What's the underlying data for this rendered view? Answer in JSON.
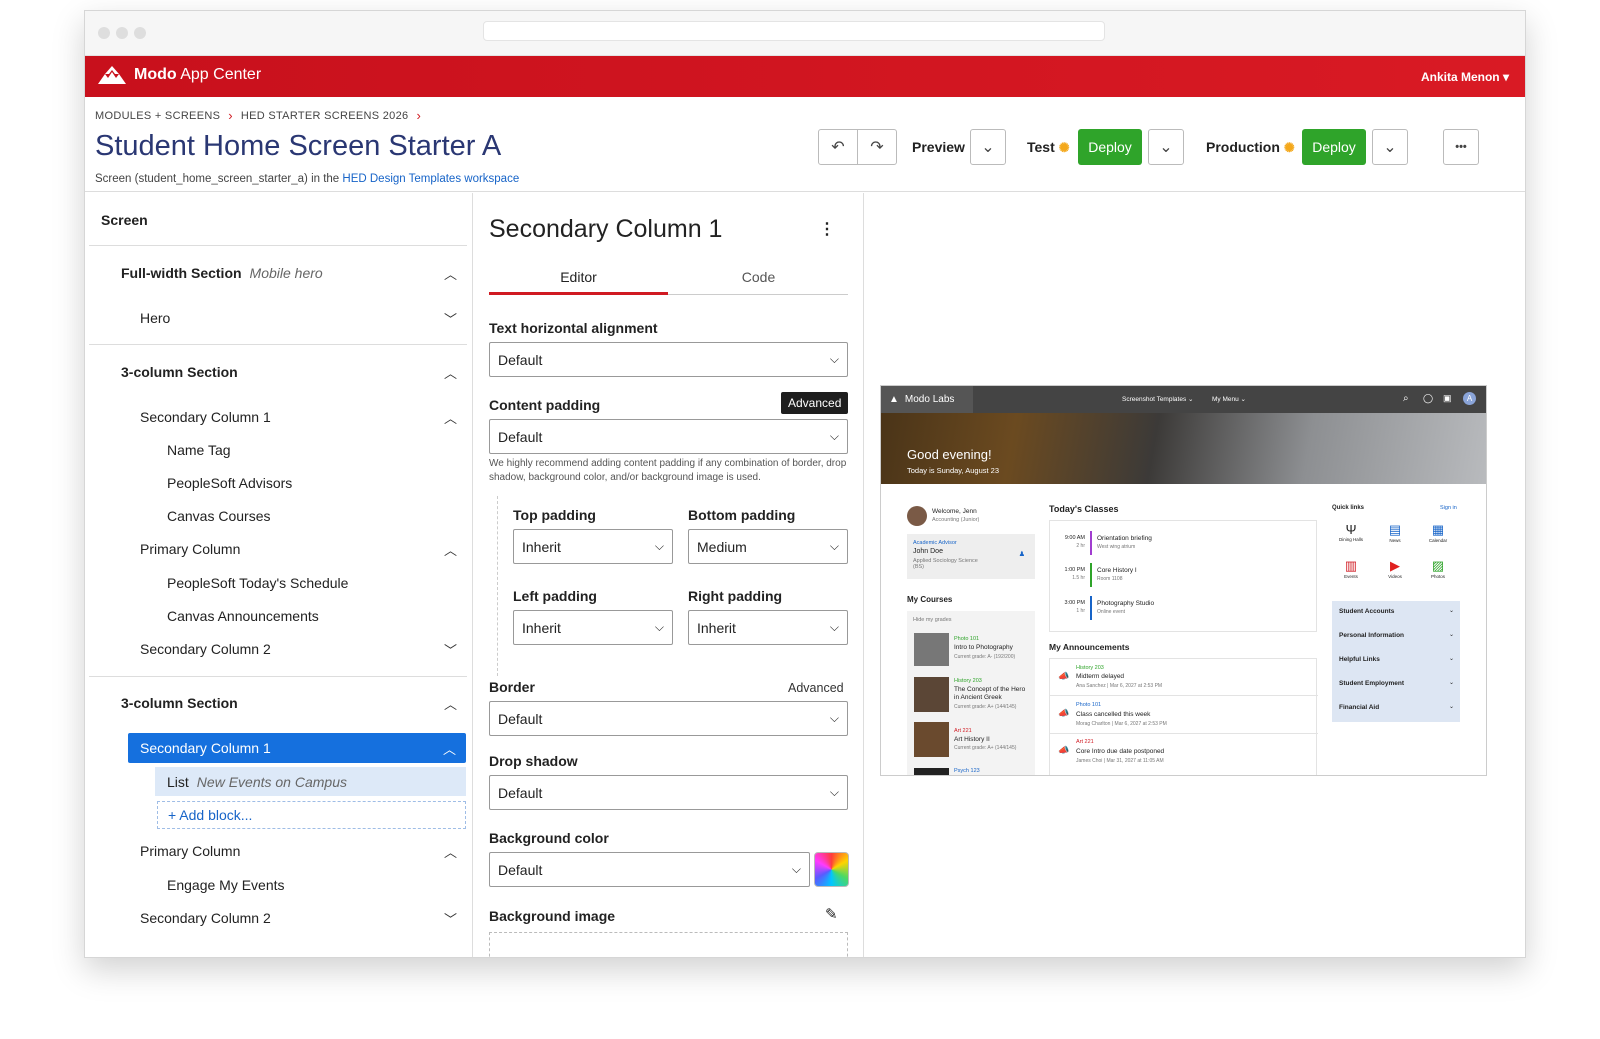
{
  "app": {
    "name_bold": "Modo",
    "name_rest": "App Center",
    "user": "Ankita Menon ▾"
  },
  "breadcrumb": [
    "MODULES + SCREENS",
    "HED STARTER SCREENS 2026"
  ],
  "page": {
    "title": "Student Home Screen Starter A",
    "subtitle_prefix": "Screen (student_home_screen_starter_a) in the ",
    "subtitle_link": "HED Design Templates workspace"
  },
  "toolbar": {
    "undo": "↶",
    "redo": "↷",
    "preview": "Preview",
    "test": "Test",
    "production": "Production",
    "deploy": "Deploy",
    "more": "•••"
  },
  "tree": {
    "header": "Screen",
    "items": [
      {
        "label": "Full-width Section",
        "note": "Mobile hero",
        "bold": true
      },
      {
        "label": "Hero"
      },
      {
        "label": "3-column Section",
        "bold": true
      },
      {
        "label": "Secondary Column 1"
      },
      {
        "label": "Name Tag"
      },
      {
        "label": "PeopleSoft Advisors"
      },
      {
        "label": "Canvas Courses"
      },
      {
        "label": "Primary Column"
      },
      {
        "label": "PeopleSoft Today's Schedule"
      },
      {
        "label": "Canvas Announcements"
      },
      {
        "label": "Secondary Column 2"
      },
      {
        "label": "3-column Section",
        "bold": true
      },
      {
        "label": "Secondary Column 1"
      },
      {
        "label": "List",
        "note": "New Events on Campus"
      },
      {
        "label": "+ Add block..."
      },
      {
        "label": "Primary Column"
      },
      {
        "label": "Engage My Events"
      },
      {
        "label": "Secondary Column 2"
      }
    ]
  },
  "editor": {
    "title": "Secondary Column 1",
    "tabs": [
      "Editor",
      "Code"
    ],
    "text_align_label": "Text horizontal alignment",
    "text_align_value": "Default",
    "content_padding_label": "Content padding",
    "advanced_badge": "Advanced",
    "content_padding_value": "Default",
    "helper": "We highly recommend adding content padding if any combination of border, drop shadow, background color, and/or background image is used.",
    "top_padding_label": "Top padding",
    "top_padding_value": "Inherit",
    "bottom_padding_label": "Bottom padding",
    "bottom_padding_value": "Medium",
    "left_padding_label": "Left padding",
    "left_padding_value": "Inherit",
    "right_padding_label": "Right padding",
    "right_padding_value": "Inherit",
    "border_label": "Border",
    "border_advanced": "Advanced",
    "border_value": "Default",
    "shadow_label": "Drop shadow",
    "shadow_value": "Default",
    "bg_color_label": "Background color",
    "bg_color_value": "Default",
    "bg_image_label": "Background image"
  },
  "preview": {
    "brand": "Modo Labs",
    "nav1": "Screenshot Templates ⌄",
    "nav2": "My Menu ⌄",
    "greeting": "Good evening!",
    "date": "Today is Sunday, August 23",
    "welcome": "Welcome, Jenn",
    "welcome_sub": "Accounting (Junior)",
    "advisor_tag": "Academic Advisor",
    "advisor_name": "John Doe",
    "advisor_dept": "Applied Sociology Science (BS)",
    "my_courses": "My Courses",
    "hide_grades": "Hide my grades",
    "courses": [
      {
        "code": "Photo 101",
        "name": "Intro to Photography",
        "grade": "Current grade: A- (192/200)"
      },
      {
        "code": "History 203",
        "name": "The Concept of the Hero in Ancient Greek",
        "grade": "Current grade: A+ (144/145)"
      },
      {
        "code": "Art 221",
        "name": "Art History II",
        "grade": "Current grade: A+ (144/145)"
      },
      {
        "code": "Psych 123",
        "name": "",
        "grade": ""
      }
    ],
    "todays_classes": "Today's Classes",
    "classes": [
      {
        "time": "9:00 AM",
        "dur": "2 hr",
        "name": "Orientation briefing",
        "place": "West wing atrium"
      },
      {
        "time": "1:00 PM",
        "dur": "1.5 hr",
        "name": "Core History I",
        "place": "Room 1108"
      },
      {
        "time": "3:00 PM",
        "dur": "1 hr",
        "name": "Photography Studio",
        "place": "Online event"
      }
    ],
    "announcements_title": "My Announcements",
    "announcements": [
      {
        "code": "History 203",
        "title": "Midterm delayed",
        "meta": "Ana Sanchez | Mar 6, 2027 at 2:53 PM"
      },
      {
        "code": "Photo 101",
        "title": "Class cancelled this week",
        "meta": "Morag Charlton | Mar 6, 2027 at 2:53 PM"
      },
      {
        "code": "Art 221",
        "title": "Core Intro due date postponed",
        "meta": "James Choi | Mar 31, 2027 at 11:05 AM"
      }
    ],
    "quick_links": "Quick links",
    "sign_in": "Sign in",
    "quick_items": [
      "Dining Halls",
      "News",
      "Calendar",
      "Events",
      "Videos",
      "Photos"
    ],
    "accordion": [
      "Student Accounts",
      "Personal Information",
      "Helpful Links",
      "Student Employment",
      "Financial Aid"
    ]
  }
}
